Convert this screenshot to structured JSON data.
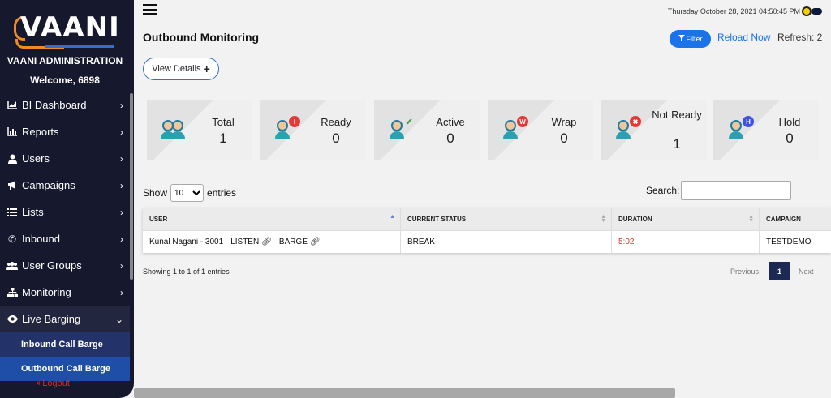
{
  "sidebar": {
    "brand": "VAANI",
    "admin_title": "VAANI ADMINISTRATION",
    "welcome": "Welcome, 6898",
    "items": [
      {
        "label": "BI Dashboard",
        "icon": "chart-area-icon"
      },
      {
        "label": "Reports",
        "icon": "bar-chart-icon"
      },
      {
        "label": "Users",
        "icon": "user-icon"
      },
      {
        "label": "Campaigns",
        "icon": "bullhorn-icon"
      },
      {
        "label": "Lists",
        "icon": "list-icon"
      },
      {
        "label": "Inbound",
        "icon": "phone-icon"
      },
      {
        "label": "User Groups",
        "icon": "users-icon"
      },
      {
        "label": "Monitoring",
        "icon": "sitemap-icon"
      },
      {
        "label": "Live Barging",
        "icon": "eye-icon"
      }
    ],
    "sub_items": [
      {
        "label": "Inbound Call Barge"
      },
      {
        "label": "Outbound Call Barge"
      }
    ],
    "logout": "Logout"
  },
  "topbar": {
    "datetime": "Thursday October 28, 2021 04:50:45 PM"
  },
  "page": {
    "title": "Outbound Monitoring",
    "filter_label": "Filter",
    "reload_label": "Reload Now",
    "refresh_label": "Refresh: 2",
    "view_details_label": "View Details"
  },
  "stats": [
    {
      "label": "Total",
      "count": "1",
      "badge": ""
    },
    {
      "label": "Ready",
      "count": "0",
      "badge": "I",
      "badge_color": "#e53935"
    },
    {
      "label": "Active",
      "count": "0",
      "badge": "✔",
      "badge_color": "#43a047"
    },
    {
      "label": "Wrap",
      "count": "0",
      "badge": "W",
      "badge_color": "#e53935"
    },
    {
      "label": "Not Ready",
      "count": "1",
      "badge": "✖",
      "badge_color": "#e53935"
    },
    {
      "label": "Hold",
      "count": "0",
      "badge": "H",
      "badge_color": "#3f51e0"
    }
  ],
  "table": {
    "show_label": "Show",
    "entries_label": "entries",
    "page_size": "10",
    "search_label": "Search:",
    "columns": [
      "USER",
      "CURRENT STATUS",
      "DURATION",
      "CAMPAIGN"
    ],
    "rows": [
      {
        "user": "Kunal Nagani - 3001",
        "listen": "LISTEN",
        "barge": "BARGE",
        "status": "BREAK",
        "duration": "5:02",
        "campaign": "TESTDEMO"
      }
    ],
    "info": "Showing 1 to 1 of 1 entries",
    "previous": "Previous",
    "current_page": "1",
    "next": "Next"
  }
}
